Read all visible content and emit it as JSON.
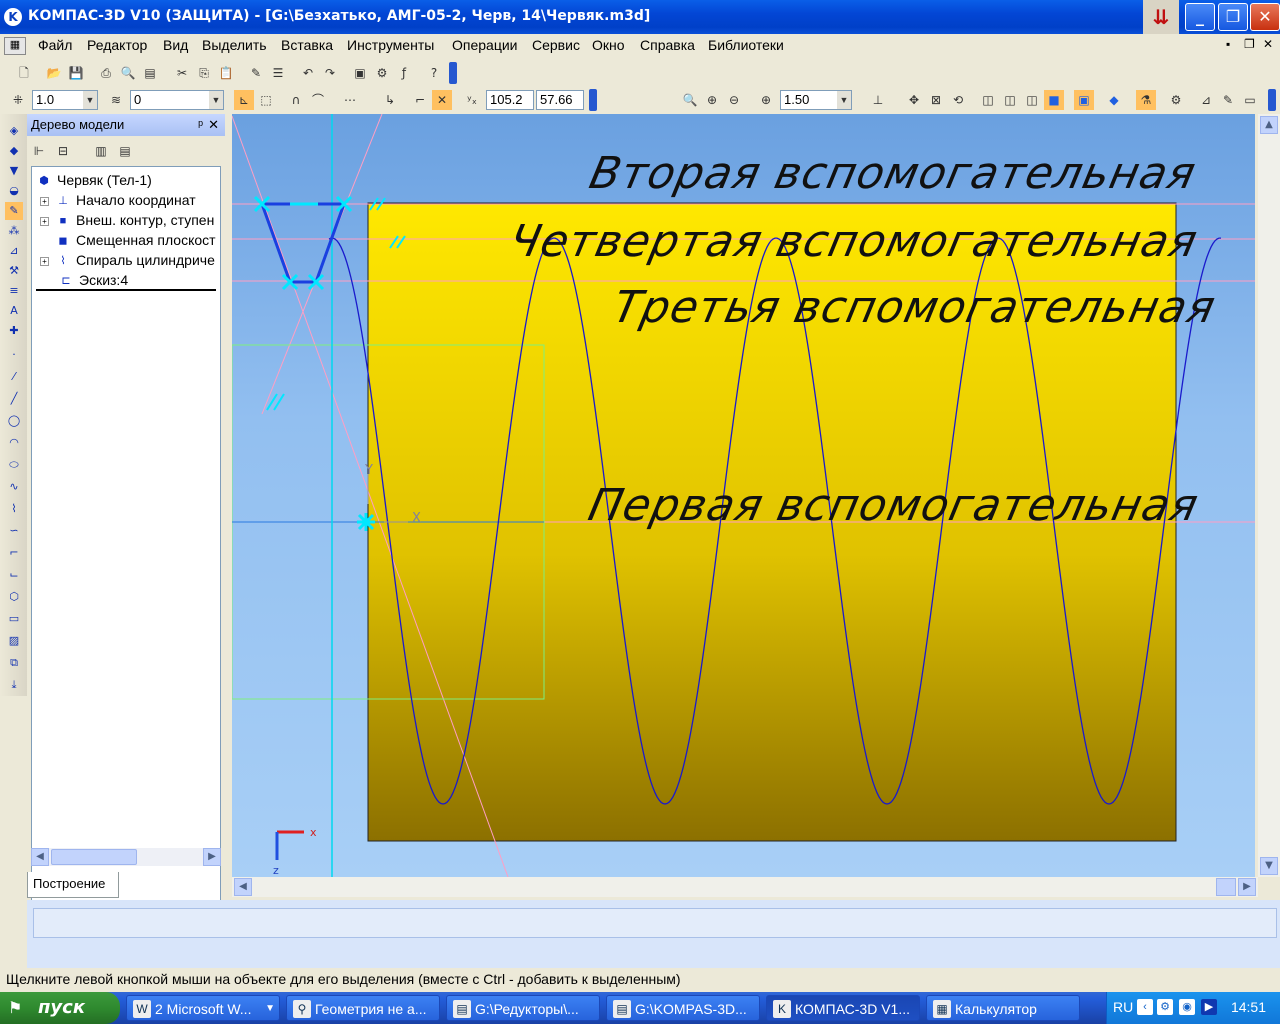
{
  "window": {
    "title": "КОМПАС-3D V10 (ЗАЩИТА) - [G:\\Безхатько, АМГ-05-2, Черв, 14\\Червяк.m3d]",
    "app_icon": "kompas-k-icon",
    "controls": [
      "minimize",
      "maximize",
      "close"
    ]
  },
  "menu": {
    "items": [
      "Файл",
      "Редактор",
      "Вид",
      "Выделить",
      "Вставка",
      "Инструменты",
      "Операции",
      "Сервис",
      "Окно",
      "Справка",
      "Библиотеки"
    ]
  },
  "toolbar_current": {
    "step": "1.0",
    "layer": "0",
    "x_coord": "105.2",
    "y_coord": "57.66",
    "zoom": "1.50"
  },
  "tree": {
    "title": "Дерево модели",
    "root": "Червяк (Тел-1)",
    "items": [
      {
        "label": "Начало координат",
        "expandable": true
      },
      {
        "label": "Внеш. контур, ступен",
        "expandable": true
      },
      {
        "label": "Смещенная плоскост",
        "expandable": false
      },
      {
        "label": "Спираль цилиндриче",
        "expandable": true
      },
      {
        "label": "Эскиз:4",
        "expandable": false
      }
    ],
    "tab": "Построение"
  },
  "viewport": {
    "labels": {
      "second": "Вторая вспомогательная",
      "fourth": "Четвертая вспомогательная",
      "third": "Третья вспомогательная",
      "first": "Первая вспомогательная"
    },
    "axis_y": "Y",
    "axis_x": "X",
    "corner_x": "x",
    "corner_z": "z",
    "colors": {
      "body_top": "#ffe800",
      "body_bottom": "#8c7000",
      "helix": "#1a1acc",
      "sketch": "#00e0ff",
      "guide": "#ff6fa8"
    }
  },
  "status": {
    "message": "Щелкните левой кнопкой мыши на объекте для его выделения (вместе с Ctrl - добавить к выделенным)"
  },
  "taskbar": {
    "start": "пуск",
    "tasks": [
      {
        "label": "2 Microsoft W...",
        "icon": "word-icon"
      },
      {
        "label": "Геометрия не а...",
        "icon": "compass-icon"
      },
      {
        "label": "G:\\Редукторы\\...",
        "icon": "folder-icon"
      },
      {
        "label": "G:\\KOMPAS-3D...",
        "icon": "folder-icon"
      },
      {
        "label": "КОМПАС-3D V1...",
        "icon": "kompas-icon"
      },
      {
        "label": "Калькулятор",
        "icon": "calculator-icon"
      }
    ],
    "lang": "RU",
    "clock": "14:51"
  }
}
